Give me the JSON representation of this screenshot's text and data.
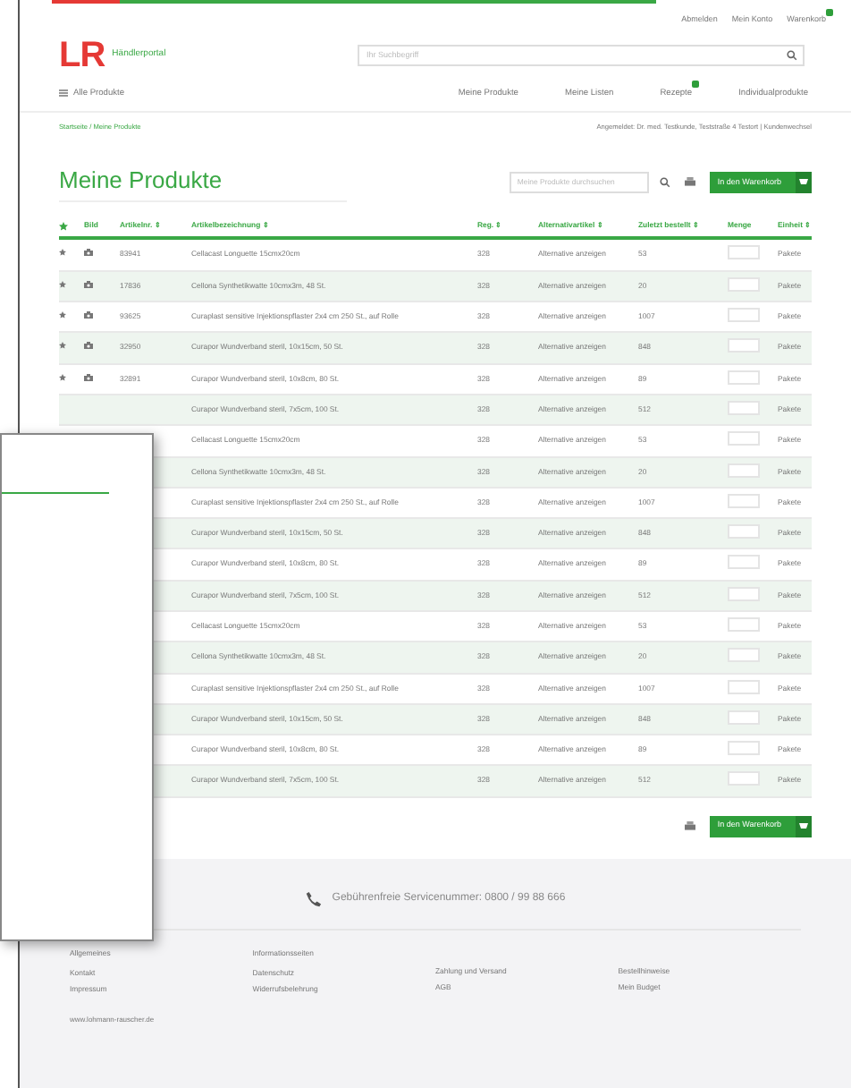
{
  "top_links": [
    "Abmelden",
    "Mein Konto",
    "Warenkorb"
  ],
  "logo": {
    "mark": "LR",
    "subtitle": "Händlerportal"
  },
  "search": {
    "placeholder": "Ihr Suchbegriff"
  },
  "nav": {
    "all_products": "Alle Produkte",
    "items": [
      {
        "label": "Meine Produkte"
      },
      {
        "label": "Meine Listen"
      },
      {
        "label": "Rezepte",
        "badge": true
      },
      {
        "label": "Individualprodukte"
      }
    ]
  },
  "breadcrumb": "Startseite / Meine Produkte",
  "login_info": "Angemeldet: Dr. med. Testkunde, Teststraße 4 Testort | Kundenwechsel",
  "title": "Meine Produkte",
  "product_search": {
    "placeholder": "Meine Produkte durchsuchen"
  },
  "cart_button": "In den Warenkorb",
  "table": {
    "columns": [
      "Bild",
      "Artikelnr. ⇕",
      "Artikelbezeichnung ⇕",
      "Reg. ⇕",
      "Alternativartikel ⇕",
      "Zuletzt bestellt ⇕",
      "Menge",
      "Einheit ⇕"
    ],
    "rows": [
      {
        "number": "83941",
        "name": "Cellacast Longuette 15cmx20cm",
        "reg": "328",
        "alt": "Alternative anzeigen",
        "last": "53",
        "unit": "Pakete"
      },
      {
        "number": "17836",
        "name": "Cellona Synthetikwatte 10cmx3m, 48 St.",
        "reg": "328",
        "alt": "Alternative anzeigen",
        "last": "20",
        "unit": "Pakete"
      },
      {
        "number": "93625",
        "name": "Curaplast sensitive Injektionspflaster 2x4 cm 250 St., auf Rolle",
        "reg": "328",
        "alt": "Alternative anzeigen",
        "last": "1007",
        "unit": "Pakete"
      },
      {
        "number": "32950",
        "name": "Curapor Wundverband steril, 10x15cm, 50 St.",
        "reg": "328",
        "alt": "Alternative anzeigen",
        "last": "848",
        "unit": "Pakete"
      },
      {
        "number": "32891",
        "name": "Curapor Wundverband steril, 10x8cm, 80 St.",
        "reg": "328",
        "alt": "Alternative anzeigen",
        "last": "89",
        "unit": "Pakete"
      },
      {
        "name": "Curapor Wundverband steril, 7x5cm, 100 St.",
        "reg": "328",
        "alt": "Alternative anzeigen",
        "last": "512",
        "unit": "Pakete"
      },
      {
        "name": "Cellacast Longuette 15cmx20cm",
        "reg": "328",
        "alt": "Alternative anzeigen",
        "last": "53",
        "unit": "Pakete"
      },
      {
        "name": "Cellona Synthetikwatte 10cmx3m, 48 St.",
        "reg": "328",
        "alt": "Alternative anzeigen",
        "last": "20",
        "unit": "Pakete"
      },
      {
        "name": "Curaplast sensitive Injektionspflaster 2x4 cm 250 St., auf Rolle",
        "reg": "328",
        "alt": "Alternative anzeigen",
        "last": "1007",
        "unit": "Pakete"
      },
      {
        "name": "Curapor Wundverband steril, 10x15cm, 50 St.",
        "reg": "328",
        "alt": "Alternative anzeigen",
        "last": "848",
        "unit": "Pakete"
      },
      {
        "name": "Curapor Wundverband steril, 10x8cm, 80 St.",
        "reg": "328",
        "alt": "Alternative anzeigen",
        "last": "89",
        "unit": "Pakete"
      },
      {
        "name": "Curapor Wundverband steril, 7x5cm, 100 St.",
        "reg": "328",
        "alt": "Alternative anzeigen",
        "last": "512",
        "unit": "Pakete"
      },
      {
        "name": "Cellacast Longuette 15cmx20cm",
        "reg": "328",
        "alt": "Alternative anzeigen",
        "last": "53",
        "unit": "Pakete"
      },
      {
        "name": "Cellona Synthetikwatte 10cmx3m, 48 St.",
        "reg": "328",
        "alt": "Alternative anzeigen",
        "last": "20",
        "unit": "Pakete"
      },
      {
        "name": "Curaplast sensitive Injektionspflaster 2x4 cm 250 St., auf Rolle",
        "reg": "328",
        "alt": "Alternative anzeigen",
        "last": "1007",
        "unit": "Pakete"
      },
      {
        "name": "Curapor Wundverband steril, 10x15cm, 50 St.",
        "reg": "328",
        "alt": "Alternative anzeigen",
        "last": "848",
        "unit": "Pakete"
      },
      {
        "name": "Curapor Wundverband steril, 10x8cm, 80 St.",
        "reg": "328",
        "alt": "Alternative anzeigen",
        "last": "89",
        "unit": "Pakete"
      },
      {
        "name": "Curapor Wundverband steril, 7x5cm, 100 St.",
        "reg": "328",
        "alt": "Alternative anzeigen",
        "last": "512",
        "unit": "Pakete"
      }
    ]
  },
  "bottom_cart_button": "In den Warenkorb",
  "footer": {
    "service": "Gebührenfreie Servicenummer: 0800 / 99 88 666",
    "columns": [
      {
        "heading": "Allgemeines",
        "links": [
          "Kontakt",
          "Impressum"
        ]
      },
      {
        "heading": "Informationsseiten",
        "links": [
          "Datenschutz",
          "Widerrufsbelehrung"
        ]
      },
      {
        "links": [
          "Zahlung und Versand",
          "AGB"
        ]
      },
      {
        "links": [
          "Bestellhinweise",
          "Mein Budget"
        ]
      }
    ],
    "url": "www.lohmann-rauscher.de"
  }
}
